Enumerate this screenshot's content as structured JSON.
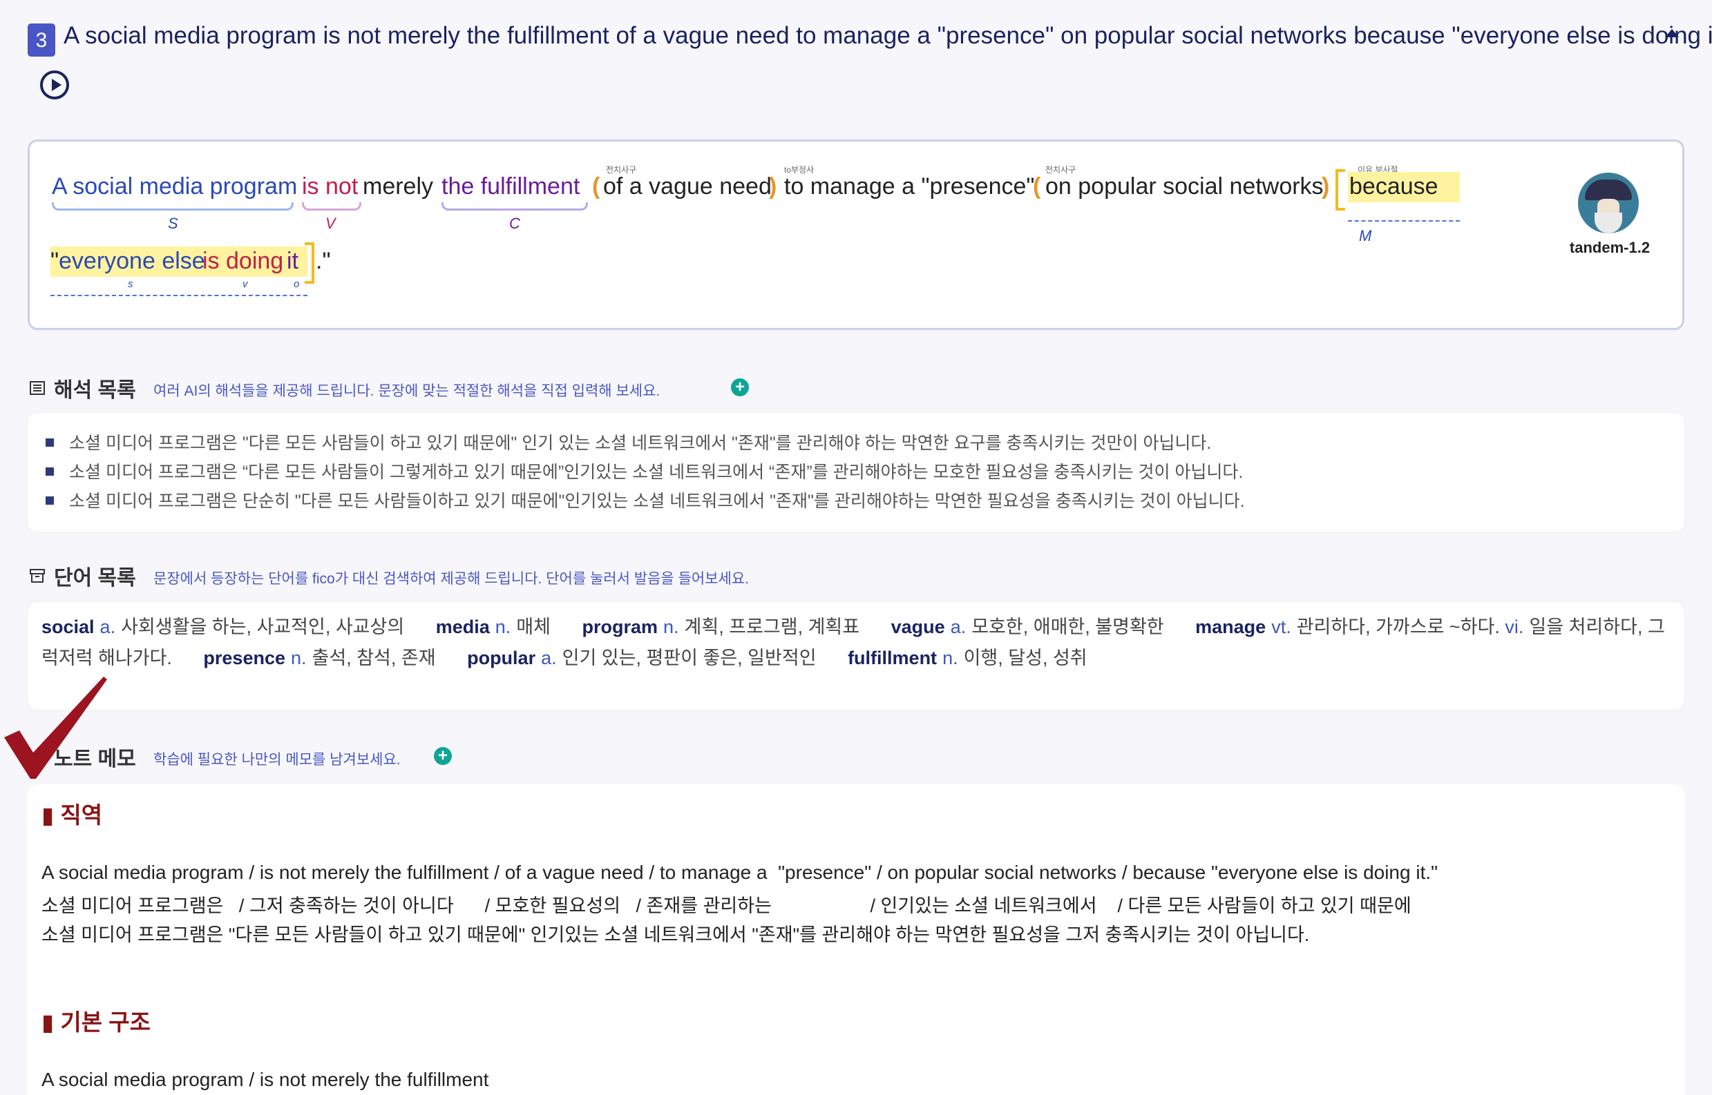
{
  "question": {
    "number": "3",
    "title": "A social media program is not merely the fulfillment of a vague need to manage a \"presence\" on popular social networks because \"everyone else is doing it.\""
  },
  "analysis": {
    "tokens": {
      "subject": "A social media program",
      "verb": "is not",
      "merely": "merely",
      "complement": "the fulfillment",
      "paren_open1": "(",
      "of_phrase": "of a vague need",
      "paren_close1": ")",
      "to_phrase": "to manage a \"presence\"",
      "paren_open2": "(",
      "on_phrase": "on popular social networks",
      "paren_close2": ")",
      "because": "because",
      "quote_open": "\"",
      "everyone": "everyone else",
      "is_doing": "is doing",
      "it": "it",
      "end": ".\""
    },
    "tags": {
      "prep1": "전치사구",
      "to_inf": "to부정사",
      "prep2": "전치사구",
      "reason": "이유 부사절"
    },
    "roles": {
      "S": "S",
      "V": "V",
      "C": "C",
      "M": "M",
      "s": "s",
      "v": "v",
      "o": "o"
    },
    "avatar_name": "tandem-1.2"
  },
  "translations_section": {
    "title": "해석 목록",
    "subtitle": "여러 AI의 해석들을 제공해 드립니다. 문장에 맞는 적절한 해석을 직접 입력해 보세요.",
    "items": [
      "소셜 미디어 프로그램은 \"다른 모든 사람들이 하고 있기 때문에\" 인기 있는 소셜 네트워크에서 \"존재\"를 관리해야 하는 막연한 요구를 충족시키는 것만이 아닙니다.",
      "소셜 미디어 프로그램은 “다른 모든 사람들이 그렇게하고 있기 때문에”인기있는 소셜 네트워크에서 “존재”를 관리해야하는 모호한 필요성을 충족시키는 것이 아닙니다.",
      "소셜 미디어 프로그램은 단순히 \"다른 모든 사람들이하고 있기 때문에\"인기있는 소셜 네트워크에서 \"존재\"를 관리해야하는 막연한 필요성을 충족시키는 것이 아닙니다."
    ]
  },
  "words_section": {
    "title": "단어 목록",
    "subtitle": "문장에서 등장하는 단어를 fico가 대신 검색하여 제공해 드립니다. 단어를 눌러서 발음을 들어보세요.",
    "entries": [
      {
        "word": "social",
        "pos": "a.",
        "meaning": "사회생활을 하는, 사교적인, 사교상의"
      },
      {
        "word": "media",
        "pos": "n.",
        "meaning": "매체"
      },
      {
        "word": "program",
        "pos": "n.",
        "meaning": "계획, 프로그램, 계획표"
      },
      {
        "word": "vague",
        "pos": "a.",
        "meaning": "모호한, 애매한, 불명확한"
      },
      {
        "word": "manage",
        "pos": "vt.",
        "meaning": "관리하다, 가까스로 ~하다.",
        "pos2": "vi.",
        "meaning2": "일을 처리하다, 그럭저럭 해나가다."
      },
      {
        "word": "presence",
        "pos": "n.",
        "meaning": "출석, 참석, 존재"
      },
      {
        "word": "popular",
        "pos": "a.",
        "meaning": "인기 있는, 평판이 좋은, 일반적인"
      },
      {
        "word": "fulfillment",
        "pos": "n.",
        "meaning": "이행, 달성, 성취"
      }
    ]
  },
  "note_section": {
    "title": "노트 메모",
    "subtitle": "학습에 필요한 나만의 메모를 남겨보세요.",
    "literal_title": "직역",
    "literal_en": "A social media program / is not merely the fulfillment / of a vague need / to manage a  \"presence\" / on popular social networks / because \"everyone else is doing it.\"",
    "literal_ko1": "소셜 미디어 프로그램은   / 그저 충족하는 것이 아니다      / 모호한 필요성의   / 존재를 관리하는                   / 인기있는 소셜 네트워크에서    / 다른 모든 사람들이 하고 있기 때문에",
    "literal_ko2": "소셜 미디어 프로그램은 \"다른 모든 사람들이 하고 있기 때문에\" 인기있는 소셜 네트워크에서 \"존재\"를 관리해야 하는 막연한 필요성을 그저 충족시키는 것이 아닙니다.",
    "structure_title": "기본 구조",
    "structure_en": "A social media program / is not merely the fulfillment"
  },
  "colors": {
    "accent": "#4a56c4",
    "title": "#1a2360",
    "note_heading": "#8a1414",
    "plus_button": "#0ea595",
    "highlight": "#fff3a0",
    "bracket": "#f2bc1b"
  }
}
